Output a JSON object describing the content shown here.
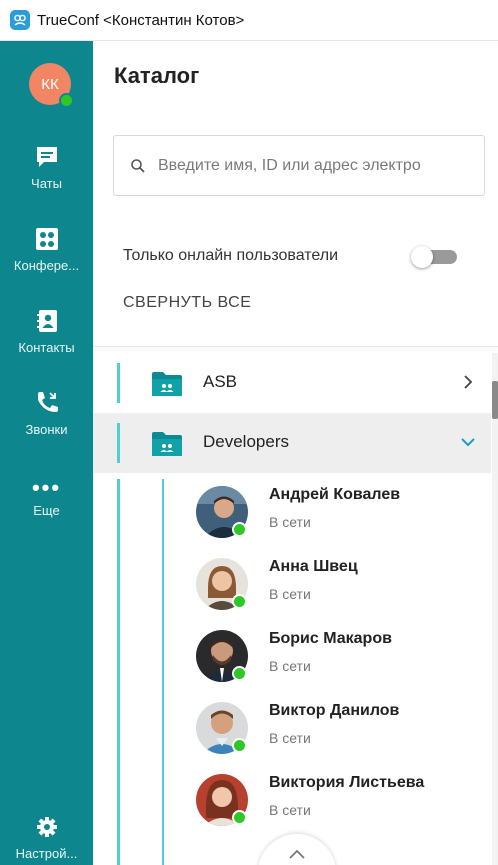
{
  "window": {
    "title": "TrueConf <Константин Котов>"
  },
  "user": {
    "initials": "КК"
  },
  "sidebar": {
    "items": [
      {
        "label": "Чаты",
        "icon": "chat-icon"
      },
      {
        "label": "Конфере...",
        "icon": "conference-icon"
      },
      {
        "label": "Контакты",
        "icon": "contacts-icon"
      },
      {
        "label": "Звонки",
        "icon": "calls-icon"
      },
      {
        "label": "Еще",
        "icon": "more-icon"
      },
      {
        "label": "Настрой...",
        "icon": "gear-icon"
      }
    ]
  },
  "main": {
    "title": "Каталог",
    "search_placeholder": "Введите имя, ID или адрес электро",
    "online_only_label": "Только онлайн пользователи",
    "online_only_enabled": false,
    "collapse_all_label": "СВЕРНУТЬ ВСЕ"
  },
  "tree": {
    "groups": [
      {
        "name": "ASB",
        "expanded": false
      },
      {
        "name": "Developers",
        "expanded": true
      }
    ],
    "contacts": [
      {
        "name": "Андрей Ковалев",
        "status": "В сети"
      },
      {
        "name": "Анна Швец",
        "status": "В сети"
      },
      {
        "name": "Борис Макаров",
        "status": "В сети"
      },
      {
        "name": "Виктор Данилов",
        "status": "В сети"
      },
      {
        "name": "Виктория Листьева",
        "status": "В сети"
      }
    ]
  },
  "colors": {
    "sidebar": "#0d878d",
    "accent": "#4fcfd0",
    "online": "#2ec826",
    "avatar_me": "#f28564"
  }
}
